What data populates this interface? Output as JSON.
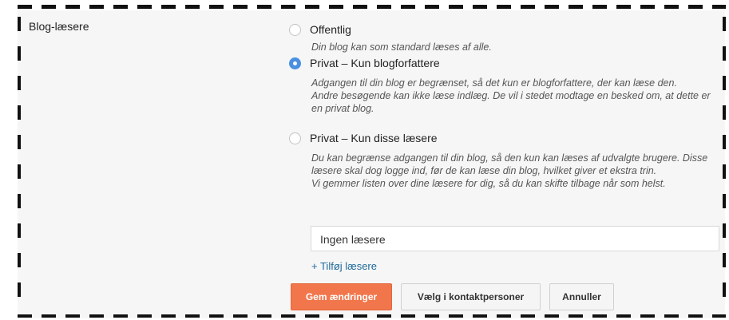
{
  "setting": {
    "label": "Blog-læsere",
    "options": [
      {
        "label": "Offentlig",
        "checked": false,
        "description": [
          "Din blog kan som standard læses af alle."
        ]
      },
      {
        "label": "Privat – Kun blogforfattere",
        "checked": true,
        "description": [
          "Adgangen til din blog er begrænset, så det kun er blogforfattere, der kan læse den.",
          "Andre besøgende kan ikke læse indlæg. De vil i stedet modtage en besked om, at dette er en privat blog."
        ]
      },
      {
        "label": "Privat – Kun disse læsere",
        "checked": false,
        "description": [
          "Du kan begrænse adgangen til din blog, så den kun kan læses af udvalgte brugere. Disse læsere skal dog logge ind, før de kan læse din blog, hvilket giver et ekstra trin.",
          "Vi gemmer listen over dine læsere for dig, så du kan skifte tilbage når som helst."
        ]
      }
    ],
    "readers_box": "Ingen læsere",
    "add_readers_link": "+ Tilføj læsere"
  },
  "actions": {
    "save": "Gem ændringer",
    "choose_contacts": "Vælg i kontaktpersoner",
    "cancel": "Annuller"
  },
  "colors": {
    "primary_button": "#f1764c",
    "radio_selected": "#4a90e2",
    "link": "#1e6a9a",
    "panel_background": "#f6f6f6",
    "border_dashes": "#111111"
  }
}
